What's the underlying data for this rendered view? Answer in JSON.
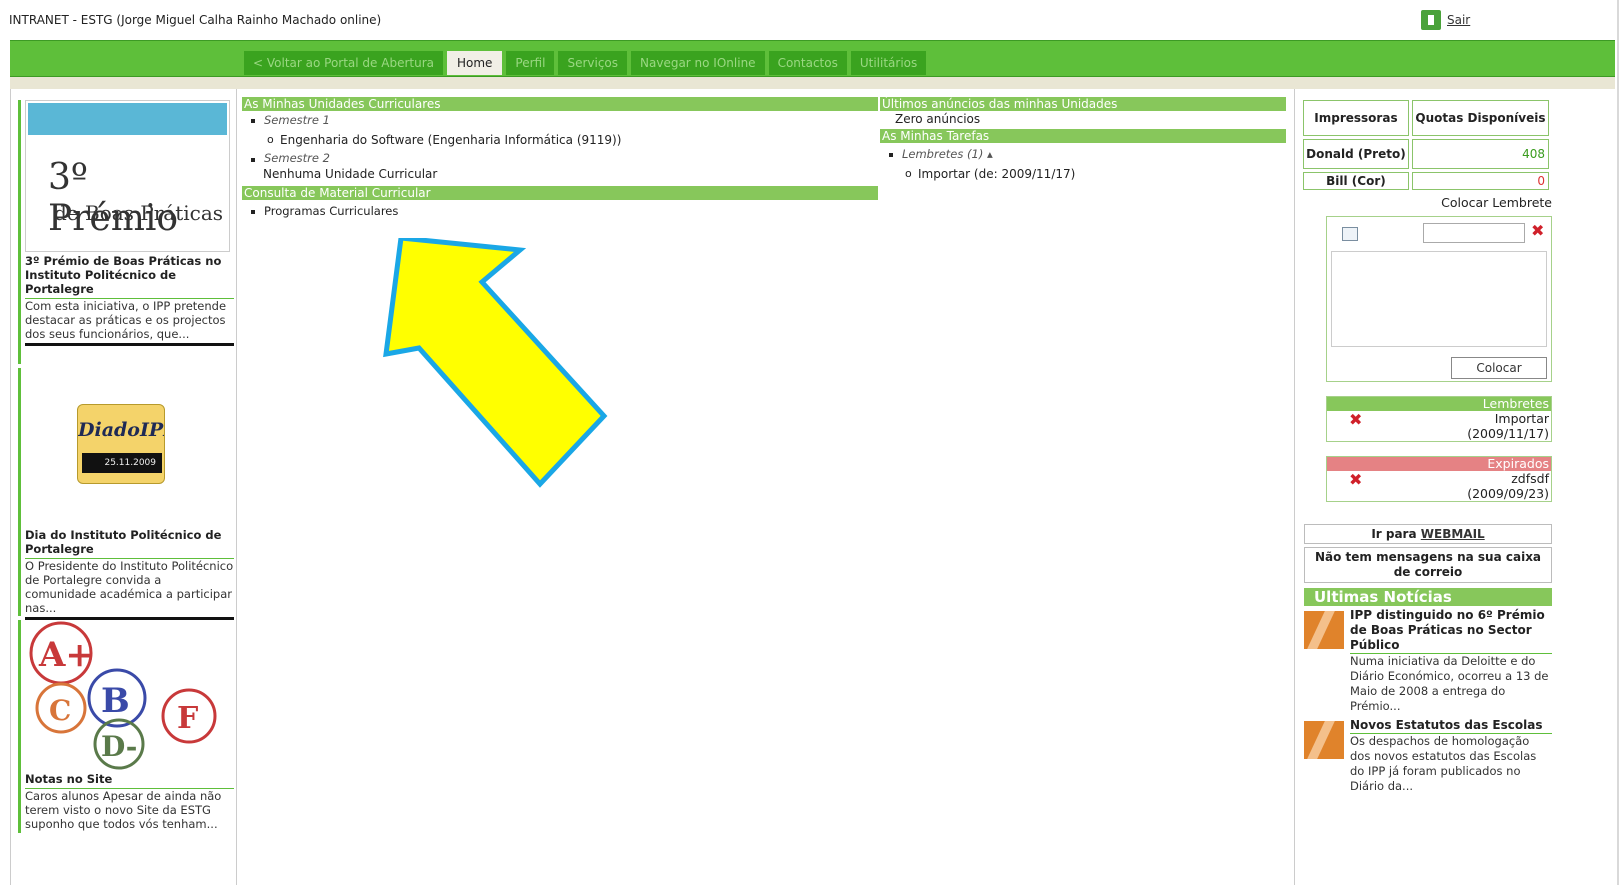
{
  "window": {
    "title": "INTRANET - ESTG (Jorge Miguel Calha Rainho Machado online)",
    "exit_label": "Sair"
  },
  "tabs": [
    {
      "label": "< Voltar ao Portal de Abertura"
    },
    {
      "label": "Home"
    },
    {
      "label": "Perfil"
    },
    {
      "label": "Serviços"
    },
    {
      "label": "Navegar no IOnline"
    },
    {
      "label": "Contactos"
    },
    {
      "label": "Utilitários"
    }
  ],
  "left": {
    "promos": [
      {
        "image_big": "3º Prémio",
        "image_small": "de Boas Práticas",
        "title": "3º Prémio de Boas Práticas no Instituto Politécnico de Portalegre",
        "text": "Com esta iniciativa, o IPP pretende destacar as práticas e os projectos dos seus funcionários, que..."
      },
      {
        "image_title": "DiadoIPP",
        "image_date": "25.11.2009",
        "title": "Dia do Instituto Politécnico de Portalegre",
        "text": "O Presidente do Instituto Politécnico de Portalegre convida a comunidade académica a participar nas..."
      },
      {
        "grades": [
          "A+",
          "C",
          "B",
          "F",
          "D-"
        ],
        "title": "Notas no Site",
        "text": "Caros alunos Apesar de ainda não terem visto o novo Site da ESTG suponho que todos vós tenham..."
      }
    ]
  },
  "units": {
    "header": "As Minhas Unidades Curriculares",
    "semester1": "Semestre 1",
    "course": "Engenharia do Software (Engenharia Informática (9119))",
    "semester2": "Semestre 2",
    "none": "Nenhuma Unidade Curricular"
  },
  "material": {
    "header": "Consulta de Material Curricular",
    "item": "Programas Curriculares"
  },
  "announcements": {
    "header": "Últimos anúncios das minhas Unidades",
    "text": "Zero anúncios"
  },
  "tasks": {
    "header": "As Minhas Tarefas",
    "reminders": "Lembretes (1) ▴",
    "item": "Importar (de: 2009/11/17)"
  },
  "quotas": {
    "col1": "Impressoras",
    "col2": "Quotas Disponíveis",
    "rows": [
      {
        "name": "Donald (Preto)",
        "value": "408"
      },
      {
        "name": "Bill (Cor)",
        "value": "0"
      }
    ]
  },
  "reminder_form": {
    "label": "Colocar Lembrete",
    "button": "Colocar"
  },
  "reminders_list": {
    "header": "Lembretes",
    "item": "Importar",
    "date": "(2009/11/17)"
  },
  "expired_list": {
    "header": "Expirados",
    "item": "zdfsdf",
    "date": "(2009/09/23)"
  },
  "webmail": {
    "prefix": "Ir para ",
    "link": "WEBMAIL",
    "status": "Não tem mensagens na sua caixa de correio"
  },
  "news": {
    "header": "Ultimas Notícias",
    "items": [
      {
        "title": "IPP distinguido no 6º Prémio de Boas Práticas no Sector Público",
        "text": "Numa iniciativa da Deloitte e do Diário Económico, ocorreu a 13 de Maio de 2008 a entrega do Prémio..."
      },
      {
        "title": "Novos Estatutos das Escolas",
        "text": "Os despachos de homologação dos novos estatutos das Escolas do IPP já foram publicados no Diário da..."
      }
    ]
  },
  "colors": {
    "green": "#5ebf3a",
    "dark_green": "#3aa31f",
    "section": "#87c75b",
    "arrow_fill": "#ffff00",
    "arrow_stroke": "#1aa7e6",
    "expired": "#e58284"
  }
}
